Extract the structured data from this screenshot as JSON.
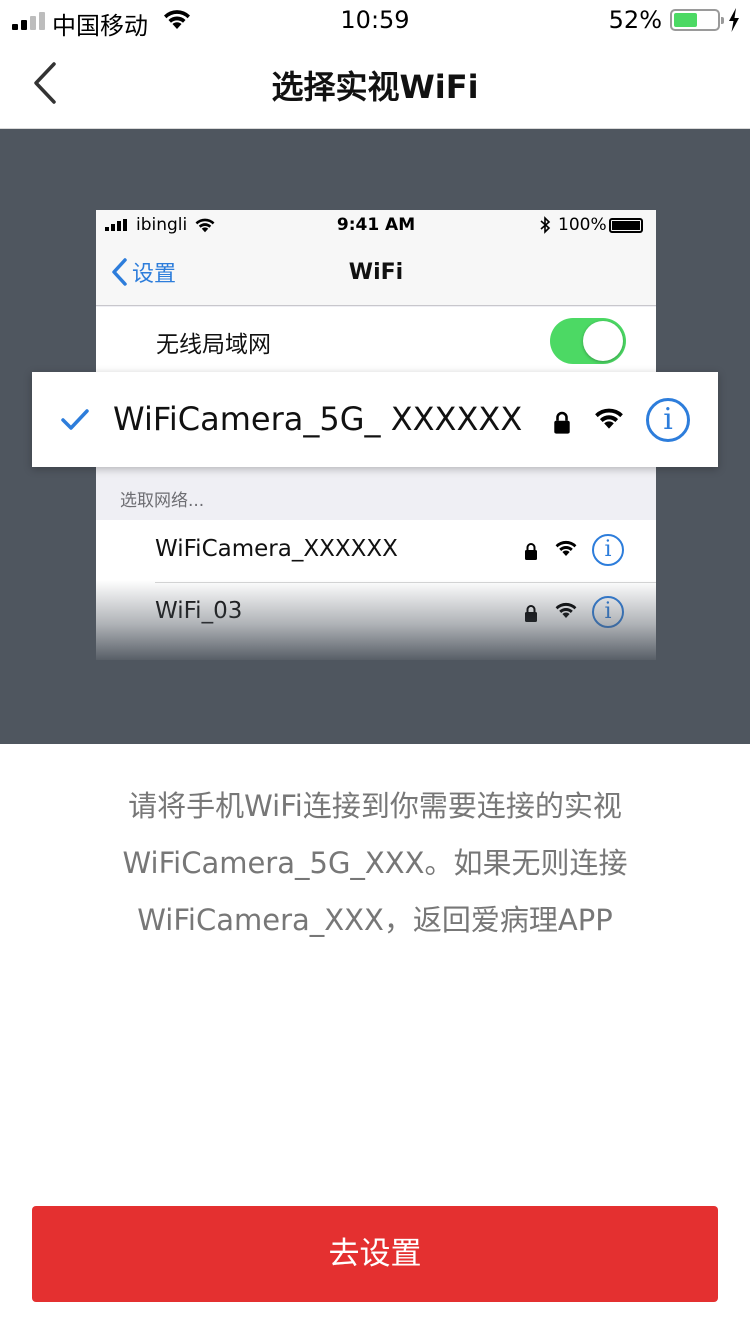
{
  "status_bar": {
    "carrier": "中国移动",
    "time": "10:59",
    "battery_pct": "52%",
    "battery_level": 0.52,
    "battery_color": "#4cd964",
    "icons": [
      "signal-icon",
      "wifi-icon",
      "battery-icon",
      "charging-bolt-icon"
    ]
  },
  "nav": {
    "back_icon": "chevron-left-icon",
    "title": "选择实视WiFi"
  },
  "illustration": {
    "phone_status": {
      "carrier": "ibingli",
      "time": "9:41 AM",
      "battery_pct": "100%"
    },
    "phone_nav": {
      "back_label": "设置",
      "title": "WiFi"
    },
    "wlan_label": "无线局域网",
    "wlan_enabled": true,
    "selected_network": "WiFiCamera_5G_ XXXXXX",
    "section_label": "选取网络...",
    "networks": [
      {
        "name": "WiFiCamera_XXXXXX"
      },
      {
        "name": "WiFi_03"
      }
    ],
    "info_glyph": "i",
    "accent_color": "#2d7ddb"
  },
  "instruction": {
    "line1": "请将手机WiFi连接到你需要连接的实视",
    "line2": "WiFiCamera_5G_XXX。如果无则连接",
    "line3": "WiFiCamera_XXX，返回爱病理APP"
  },
  "action": {
    "button_label": "去设置",
    "button_color": "#e43030"
  }
}
